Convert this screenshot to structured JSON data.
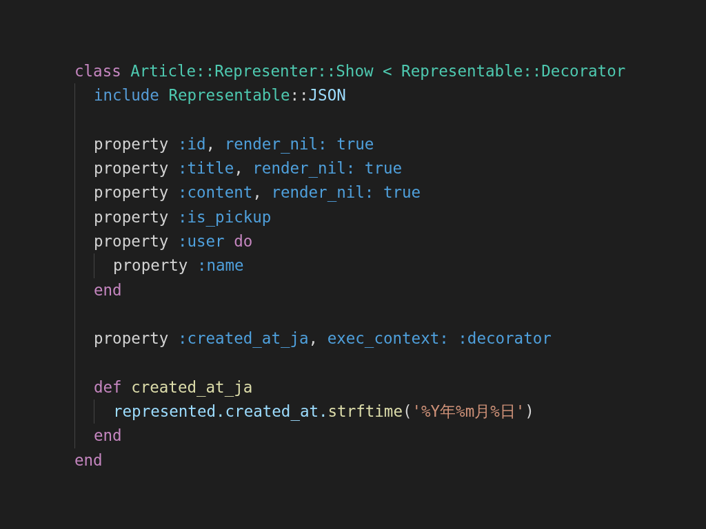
{
  "code": {
    "lines": [
      {
        "kind": "code",
        "tokens": [
          {
            "kind": "keyword",
            "text": "class "
          },
          {
            "kind": "type",
            "text": "Article::Representer::Show < Representable::Decorator"
          }
        ],
        "children": [
          {
            "kind": "code",
            "tokens": [
              {
                "kind": "builtin",
                "text": "include "
              },
              {
                "kind": "type",
                "text": "Representable"
              },
              {
                "kind": "plain",
                "text": "::"
              },
              {
                "kind": "variable",
                "text": "JSON"
              }
            ]
          },
          {
            "kind": "blank"
          },
          {
            "kind": "code",
            "tokens": [
              {
                "kind": "plain",
                "text": "property "
              },
              {
                "kind": "symbol",
                "text": ":id"
              },
              {
                "kind": "plain",
                "text": ", "
              },
              {
                "kind": "symbol",
                "text": "render_nil: true"
              }
            ]
          },
          {
            "kind": "code",
            "tokens": [
              {
                "kind": "plain",
                "text": "property "
              },
              {
                "kind": "symbol",
                "text": ":title"
              },
              {
                "kind": "plain",
                "text": ", "
              },
              {
                "kind": "symbol",
                "text": "render_nil: true"
              }
            ]
          },
          {
            "kind": "code",
            "tokens": [
              {
                "kind": "plain",
                "text": "property "
              },
              {
                "kind": "symbol",
                "text": ":content"
              },
              {
                "kind": "plain",
                "text": ", "
              },
              {
                "kind": "symbol",
                "text": "render_nil: true"
              }
            ]
          },
          {
            "kind": "code",
            "tokens": [
              {
                "kind": "plain",
                "text": "property "
              },
              {
                "kind": "symbol",
                "text": ":is_pickup"
              }
            ]
          },
          {
            "kind": "code",
            "tokens": [
              {
                "kind": "plain",
                "text": "property "
              },
              {
                "kind": "symbol",
                "text": ":user "
              },
              {
                "kind": "keyword",
                "text": "do"
              }
            ],
            "children": [
              {
                "kind": "code",
                "tokens": [
                  {
                    "kind": "plain",
                    "text": "property "
                  },
                  {
                    "kind": "symbol",
                    "text": ":name"
                  }
                ]
              }
            ]
          },
          {
            "kind": "code",
            "tokens": [
              {
                "kind": "keyword",
                "text": "end"
              }
            ]
          },
          {
            "kind": "blank"
          },
          {
            "kind": "code",
            "tokens": [
              {
                "kind": "plain",
                "text": "property "
              },
              {
                "kind": "symbol",
                "text": ":created_at_ja"
              },
              {
                "kind": "plain",
                "text": ", "
              },
              {
                "kind": "symbol",
                "text": "exec_context: :decorator"
              }
            ]
          },
          {
            "kind": "blank"
          },
          {
            "kind": "code",
            "tokens": [
              {
                "kind": "keyword",
                "text": "def "
              },
              {
                "kind": "function",
                "text": "created_at_ja"
              }
            ],
            "children": [
              {
                "kind": "code",
                "tokens": [
                  {
                    "kind": "variable",
                    "text": "represented.created_at."
                  },
                  {
                    "kind": "function",
                    "text": "strftime"
                  },
                  {
                    "kind": "plain",
                    "text": "("
                  },
                  {
                    "kind": "string",
                    "text": "'%Y年%m月%日'"
                  },
                  {
                    "kind": "plain",
                    "text": ")"
                  }
                ]
              }
            ]
          },
          {
            "kind": "code",
            "tokens": [
              {
                "kind": "keyword",
                "text": "end"
              }
            ]
          }
        ]
      },
      {
        "kind": "code",
        "tokens": [
          {
            "kind": "keyword",
            "text": "end"
          }
        ]
      }
    ]
  }
}
